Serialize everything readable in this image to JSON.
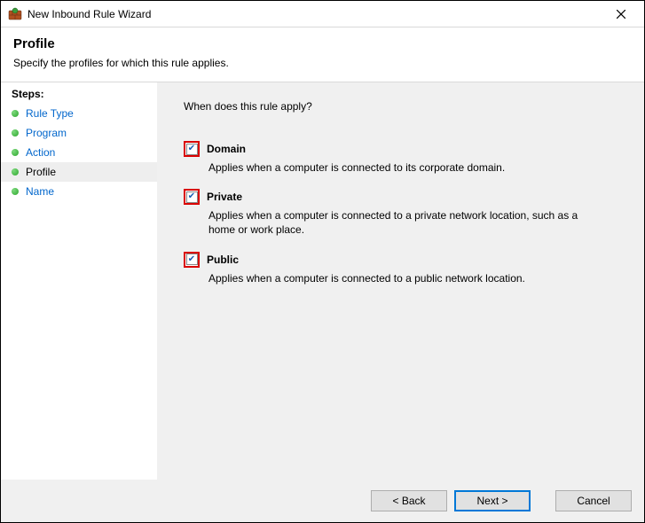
{
  "window": {
    "title": "New Inbound Rule Wizard"
  },
  "header": {
    "title": "Profile",
    "subtitle": "Specify the profiles for which this rule applies."
  },
  "steps": {
    "header": "Steps:",
    "items": [
      {
        "label": "Rule Type",
        "current": false
      },
      {
        "label": "Program",
        "current": false
      },
      {
        "label": "Action",
        "current": false
      },
      {
        "label": "Profile",
        "current": true
      },
      {
        "label": "Name",
        "current": false
      }
    ]
  },
  "content": {
    "prompt": "When does this rule apply?",
    "options": [
      {
        "key": "domain",
        "label": "Domain",
        "checked": true,
        "desc": "Applies when a computer is connected to its corporate domain."
      },
      {
        "key": "private",
        "label": "Private",
        "checked": true,
        "desc": "Applies when a computer is connected to a private network location, such as a home or work place."
      },
      {
        "key": "public",
        "label": "Public",
        "checked": true,
        "desc": "Applies when a computer is connected to a public network location."
      }
    ]
  },
  "buttons": {
    "back": "< Back",
    "next": "Next >",
    "cancel": "Cancel"
  }
}
